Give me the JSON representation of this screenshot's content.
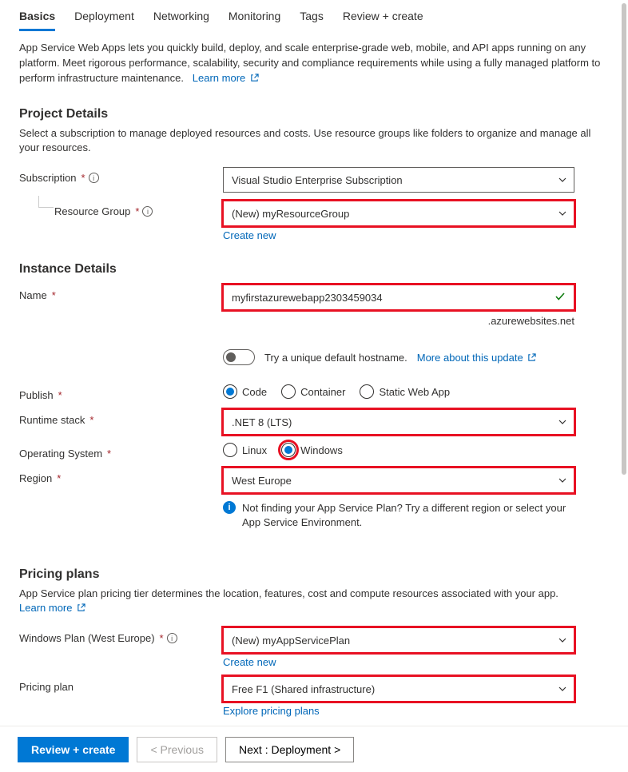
{
  "tabs": [
    "Basics",
    "Deployment",
    "Networking",
    "Monitoring",
    "Tags",
    "Review + create"
  ],
  "activeTab": 0,
  "intro": "App Service Web Apps lets you quickly build, deploy, and scale enterprise-grade web, mobile, and API apps running on any platform. Meet rigorous performance, scalability, security and compliance requirements while using a fully managed platform to perform infrastructure maintenance.",
  "introLink": "Learn more",
  "projectDetails": {
    "heading": "Project Details",
    "desc": "Select a subscription to manage deployed resources and costs. Use resource groups like folders to organize and manage all your resources.",
    "subscriptionLabel": "Subscription",
    "subscriptionValue": "Visual Studio Enterprise Subscription",
    "resourceGroupLabel": "Resource Group",
    "resourceGroupValue": "(New) myResourceGroup",
    "createNew": "Create new"
  },
  "instanceDetails": {
    "heading": "Instance Details",
    "nameLabel": "Name",
    "nameValue": "myfirstazurewebapp2303459034",
    "domainSuffix": ".azurewebsites.net",
    "toggleLabel": "Try a unique default hostname.",
    "toggleLink": "More about this update",
    "publishLabel": "Publish",
    "publishOptions": [
      "Code",
      "Container",
      "Static Web App"
    ],
    "publishSelected": 0,
    "runtimeLabel": "Runtime stack",
    "runtimeValue": ".NET 8 (LTS)",
    "osLabel": "Operating System",
    "osOptions": [
      "Linux",
      "Windows"
    ],
    "osSelected": 1,
    "regionLabel": "Region",
    "regionValue": "West Europe",
    "regionInfo": "Not finding your App Service Plan? Try a different region or select your App Service Environment."
  },
  "pricing": {
    "heading": "Pricing plans",
    "desc": "App Service plan pricing tier determines the location, features, cost and compute resources associated with your app.",
    "learnMore": "Learn more",
    "planLabel": "Windows Plan (West Europe)",
    "planValue": "(New) myAppServicePlan",
    "createNew": "Create new",
    "pricingPlanLabel": "Pricing plan",
    "pricingPlanValue": "Free F1 (Shared infrastructure)",
    "explore": "Explore pricing plans"
  },
  "footer": {
    "review": "Review + create",
    "prev": "< Previous",
    "next": "Next : Deployment >"
  }
}
